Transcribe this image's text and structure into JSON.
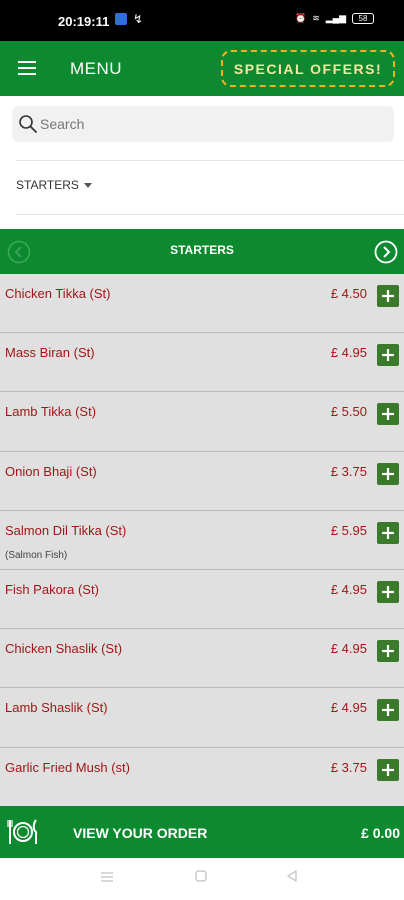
{
  "status_bar": {
    "time": "20:19:11",
    "battery": "58"
  },
  "header": {
    "title": "MENU",
    "special_label": "SPECIAL OFFERS!"
  },
  "search": {
    "placeholder": "Search"
  },
  "category": {
    "selected": "STARTERS"
  },
  "section": {
    "title": "STARTERS"
  },
  "items": [
    {
      "name": "Chicken Tikka (St)",
      "price": "£ 4.50",
      "note": ""
    },
    {
      "name": "Mass Biran (St)",
      "price": "£ 4.95",
      "note": ""
    },
    {
      "name": "Lamb Tikka (St)",
      "price": "£ 5.50",
      "note": ""
    },
    {
      "name": "Onion Bhaji (St)",
      "price": "£ 3.75",
      "note": ""
    },
    {
      "name": "Salmon Dil Tikka (St)",
      "price": "£ 5.95",
      "note": "(Salmon Fish)"
    },
    {
      "name": "Fish Pakora (St)",
      "price": "£ 4.95",
      "note": ""
    },
    {
      "name": "Chicken Shaslik (St)",
      "price": "£ 4.95",
      "note": ""
    },
    {
      "name": "Lamb Shaslik (St)",
      "price": "£ 4.95",
      "note": ""
    },
    {
      "name": "Garlic Fried Mush (st)",
      "price": "£ 3.75",
      "note": ""
    }
  ],
  "order": {
    "label": "VIEW YOUR ORDER",
    "total": "£ 0.00"
  },
  "colors": {
    "brand_green": "#0d8a2f",
    "item_text_red": "#a01717",
    "add_button_green": "#3b7a2a",
    "special_border": "#f2b21c"
  },
  "icons": [
    "hamburger-icon",
    "search-icon",
    "chevron-left-icon",
    "chevron-right-icon",
    "plus-icon",
    "plate-cutlery-icon"
  ]
}
